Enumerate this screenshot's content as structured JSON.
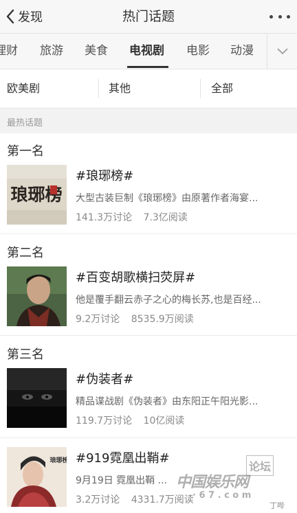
{
  "header": {
    "back_label": "发现",
    "title": "热门话题"
  },
  "tabs": [
    {
      "label": "理财",
      "active": false
    },
    {
      "label": "旅游",
      "active": false
    },
    {
      "label": "美食",
      "active": false
    },
    {
      "label": "电视剧",
      "active": true
    },
    {
      "label": "电影",
      "active": false
    },
    {
      "label": "动漫",
      "active": false
    }
  ],
  "filters": [
    "欧美剧",
    "其他",
    "全部"
  ],
  "section_title": "最热话题",
  "topics": [
    {
      "rank": "第一名",
      "title": "#琅琊榜#",
      "desc": "大型古装巨制《琅琊榜》由原著作者海宴...",
      "discussions": "141.3万讨论",
      "reads": "7.3亿阅读",
      "thumb_text": "琅琊榜"
    },
    {
      "rank": "第二名",
      "title": "#百变胡歌横扫荧屏#",
      "desc": "他是覆手翻云赤子之心的梅长苏,也是百经...",
      "discussions": "9.2万讨论",
      "reads": "8535.9万阅读"
    },
    {
      "rank": "第三名",
      "title": "#伪装者#",
      "desc": "精品谍战剧《伪装者》由东阳正午阳光影...",
      "discussions": "119.7万讨论",
      "reads": "10亿阅读"
    },
    {
      "title": "#919霓凰出鞘#",
      "desc": "9月19日 霓凰出鞘 ...",
      "discussions": "3.2万讨论",
      "reads": "4331.7万阅读",
      "thumb_text": "琅琊榜"
    }
  ],
  "watermark": {
    "site": "中国娱乐网",
    "forum": "论坛",
    "domain": "· 6 7 . c o m",
    "handle": "丁哔"
  }
}
